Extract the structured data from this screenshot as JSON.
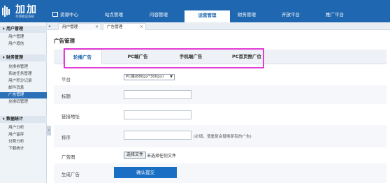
{
  "brand": {
    "name": "加加",
    "subtitle": "手游联运系统"
  },
  "nav": {
    "items": [
      {
        "label": "资源中心"
      },
      {
        "label": "站点管理"
      },
      {
        "label": "内容管理"
      },
      {
        "label": "运营管理",
        "active": true
      },
      {
        "label": "财务管理"
      },
      {
        "label": "开放平台"
      },
      {
        "label": "推广平台"
      }
    ]
  },
  "sidebar": {
    "sections": [
      {
        "title": "用户管理",
        "items": [
          "用户管理",
          "用户增信"
        ]
      },
      {
        "title": "财务管理",
        "items": [
          "兑换券管理",
          "系统任务管理",
          "用户积分记录",
          "邮件消息",
          "广告管理",
          "兑换码管理"
        ],
        "active_item": "广告管理"
      },
      {
        "title": "数据统计",
        "items": [
          "用户分析",
          "用户留存",
          "付费分析",
          "下载统计"
        ]
      }
    ]
  },
  "open_tabs": [
    {
      "label": "用户管理",
      "close": "×"
    },
    {
      "label": "广告管理",
      "close": "×",
      "active": true
    }
  ],
  "page": {
    "title": "广告管理",
    "subtabs": [
      {
        "label": "轮播广告",
        "active": true
      },
      {
        "label": "PC端广告"
      },
      {
        "label": "手机端广告"
      },
      {
        "label": "PC首页推广位"
      }
    ]
  },
  "form": {
    "platform": {
      "label": "平台",
      "value": "PC端(880px*300px)",
      "caret": "▼"
    },
    "title": {
      "label": "标题",
      "value": ""
    },
    "link": {
      "label": "链接地址",
      "value": ""
    },
    "sort": {
      "label": "排序",
      "value": "",
      "hint": "(必填，值重复会替换原有的广告)"
    },
    "image": {
      "label": "广告图",
      "button": "选择文件",
      "status": "未选择任何文件"
    },
    "generate": {
      "label": "生成广告",
      "button": "确认提交"
    }
  },
  "colors": {
    "brand_blue": "#1f67b0",
    "highlight": "#e43cd5",
    "submit": "#1a6fc4"
  }
}
